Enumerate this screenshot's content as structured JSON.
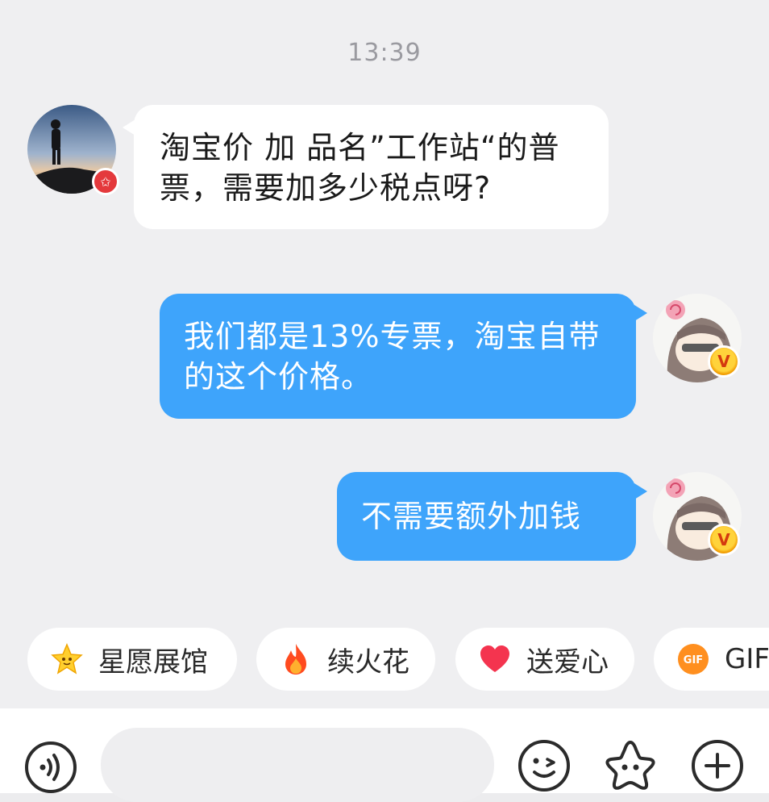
{
  "chat": {
    "timestamp": "13:39",
    "messages": [
      {
        "side": "incoming",
        "text": "淘宝价 加 品名”工作站“的普票，需要加多少税点呀?"
      },
      {
        "side": "outgoing",
        "text": "我们都是13%专票，淘宝自带的这个价格。"
      },
      {
        "side": "outgoing",
        "text": "不需要额外加钱"
      }
    ],
    "badges": {
      "contact": "✩",
      "self": "V"
    }
  },
  "quick_actions": [
    {
      "label": "星愿展馆",
      "icon": "star-emoji-icon"
    },
    {
      "label": "续火花",
      "icon": "fire-icon"
    },
    {
      "label": "送爱心",
      "icon": "heart-icon"
    },
    {
      "label": "GIF",
      "icon": "gif-icon",
      "icon_text": "GIF"
    }
  ],
  "input_bar": {
    "placeholder": "",
    "icons": [
      "voice-icon",
      "emoji-icon",
      "sticker-star-icon",
      "plus-icon"
    ]
  },
  "colors": {
    "outgoing_bubble": "#3ea4fb",
    "incoming_bubble": "#ffffff",
    "background": "#efeff1"
  }
}
